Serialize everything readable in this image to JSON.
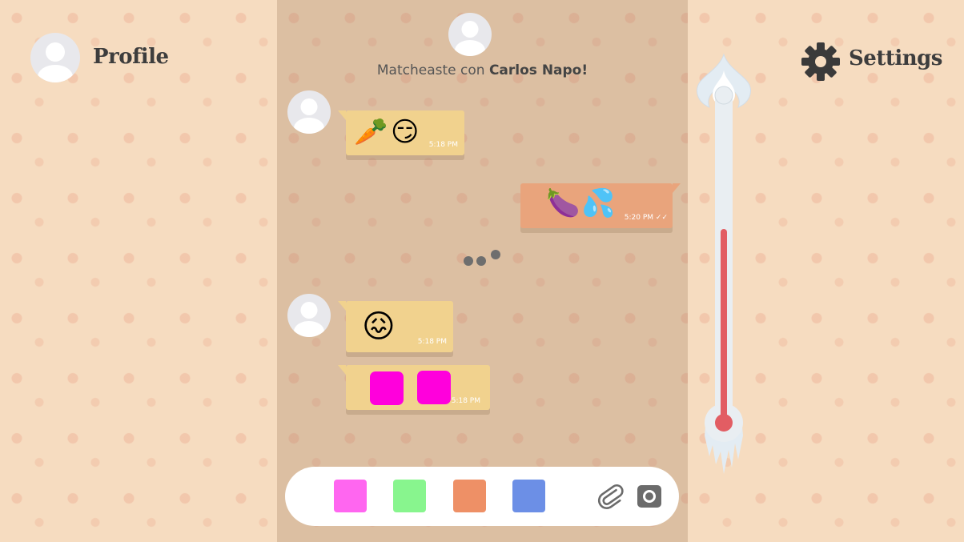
{
  "nav": {
    "profile_label": "Profile",
    "settings_label": "Settings"
  },
  "match": {
    "prefix": "Matcheaste con",
    "name": "Carlos Napo!"
  },
  "messages": [
    {
      "direction": "incoming",
      "emojis": [
        "🥕",
        "😏"
      ],
      "time": "5:18 PM"
    },
    {
      "direction": "outgoing",
      "emojis": [
        "🍆",
        "💦"
      ],
      "time": "5:20 PM",
      "status": "read"
    },
    {
      "direction": "incoming",
      "emojis": [
        "😖"
      ],
      "time": "5:18 PM"
    },
    {
      "direction": "incoming",
      "stickers": [
        "#ff00dc",
        "#ff00dc"
      ],
      "time": "5:18 PM"
    }
  ],
  "composer": {
    "swatches": [
      "#ff66f0",
      "#88f58e",
      "#ee9066",
      "#6c8fe6"
    ],
    "attach_icon": "paperclip-icon",
    "camera_icon": "camera-icon"
  },
  "heat_meter": {
    "level": 0.6,
    "colors": {
      "fill": "#e25d63",
      "tube": "#e9eef2",
      "flame": "#dfe9f0"
    }
  }
}
